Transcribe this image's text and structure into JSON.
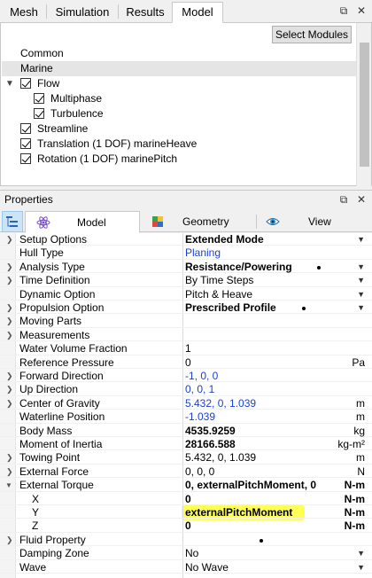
{
  "tabs": [
    {
      "label": "Mesh"
    },
    {
      "label": "Simulation"
    },
    {
      "label": "Results"
    },
    {
      "label": "Model"
    }
  ],
  "select_modules_label": "Select Modules",
  "tree": [
    {
      "label": "Common",
      "checked": false
    },
    {
      "label": "Marine",
      "checked": false
    },
    {
      "label": "Flow",
      "checked": true
    },
    {
      "label": "Multiphase",
      "checked": true
    },
    {
      "label": "Turbulence",
      "checked": true
    },
    {
      "label": "Streamline",
      "checked": true
    },
    {
      "label": "Translation (1 DOF) marineHeave",
      "checked": true
    },
    {
      "label": "Rotation (1 DOF) marinePitch",
      "checked": true
    }
  ],
  "properties_title": "Properties",
  "prop_tabs": [
    {
      "label": "Model",
      "icon": "atom-icon"
    },
    {
      "label": "Geometry",
      "icon": "cube-icon"
    },
    {
      "label": "View",
      "icon": "eye-icon"
    }
  ],
  "rows": [
    {
      "name": "Setup Options",
      "value": "Extended Mode",
      "unit": ""
    },
    {
      "name": "Hull Type",
      "value": "Planing",
      "unit": ""
    },
    {
      "name": "Analysis Type",
      "value": "Resistance/Powering",
      "unit": ""
    },
    {
      "name": "Time Definition",
      "value": "By Time Steps",
      "unit": ""
    },
    {
      "name": "Dynamic Option",
      "value": "Pitch & Heave",
      "unit": ""
    },
    {
      "name": "Propulsion Option",
      "value": "Prescribed Profile",
      "unit": ""
    },
    {
      "name": "Moving Parts",
      "value": "",
      "unit": ""
    },
    {
      "name": "Measurements",
      "value": "",
      "unit": ""
    },
    {
      "name": "Water Volume Fraction",
      "value": "1",
      "unit": ""
    },
    {
      "name": "Reference Pressure",
      "value": "0",
      "unit": "Pa"
    },
    {
      "name": "Forward Direction",
      "value": "-1, 0, 0",
      "unit": ""
    },
    {
      "name": "Up Direction",
      "value": "0, 0, 1",
      "unit": ""
    },
    {
      "name": "Center of Gravity",
      "value": "5.432, 0, 1.039",
      "unit": "m"
    },
    {
      "name": "Waterline Position",
      "value": "-1.039",
      "unit": "m"
    },
    {
      "name": "Body Mass",
      "value": "4535.9259",
      "unit": "kg"
    },
    {
      "name": "Moment of Inertia",
      "value": "28166.588",
      "unit": "kg-m²"
    },
    {
      "name": "Towing Point",
      "value": "5.432, 0, 1.039",
      "unit": "m"
    },
    {
      "name": "External Force",
      "value": "0, 0, 0",
      "unit": "N"
    },
    {
      "name": "External Torque",
      "value": "0, externalPitchMoment, 0",
      "unit": "N-m"
    },
    {
      "name": "X",
      "value": "0",
      "unit": "N-m"
    },
    {
      "name": "Y",
      "value": "externalPitchMoment",
      "unit": "N-m"
    },
    {
      "name": "Z",
      "value": "0",
      "unit": "N-m"
    },
    {
      "name": "Fluid Property",
      "value": "",
      "unit": ""
    },
    {
      "name": "Damping Zone",
      "value": "No",
      "unit": ""
    },
    {
      "name": "Wave",
      "value": "No Wave",
      "unit": ""
    }
  ],
  "colors": {
    "link_blue": "#1a3fd8",
    "highlight": "#ffff4d"
  }
}
